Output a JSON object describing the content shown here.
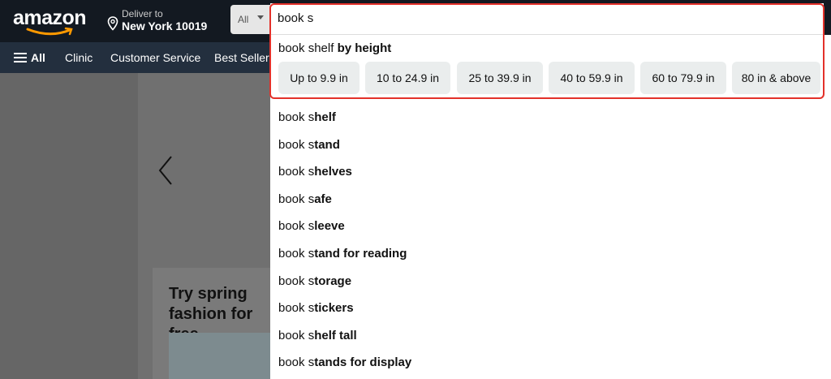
{
  "header": {
    "logo_text": "amazon",
    "deliver_label": "Deliver to",
    "deliver_location": "New York 10019",
    "search_category": "All",
    "search_value": "book s"
  },
  "nav": {
    "all_label": "All",
    "items": [
      "Clinic",
      "Customer Service",
      "Best Sellers"
    ]
  },
  "background": {
    "card_title": "Try spring fashion for free"
  },
  "dropdown": {
    "featured": {
      "prefix": "book shelf",
      "suffix": "by height"
    },
    "chips": [
      "Up to 9.9 in",
      "10 to 24.9 in",
      "25 to 39.9 in",
      "40 to 59.9 in",
      "60 to 79.9 in",
      "80 in & above"
    ],
    "suggestion_prefix": "book s",
    "suggestions": [
      {
        "typed": "book s",
        "completion": "helf"
      },
      {
        "typed": "book s",
        "completion": "tand"
      },
      {
        "typed": "book s",
        "completion": "helves"
      },
      {
        "typed": "book s",
        "completion": "afe"
      },
      {
        "typed": "book s",
        "completion": "leeve"
      },
      {
        "typed": "book s",
        "completion": "tand for reading"
      },
      {
        "typed": "book s",
        "completion": "torage"
      },
      {
        "typed": "book s",
        "completion": "tickers"
      },
      {
        "typed": "book s",
        "completion": "helf tall"
      },
      {
        "typed": "book s",
        "completion": "tands for display"
      }
    ]
  },
  "colors": {
    "header_bg": "#131921",
    "nav_bg": "#232f3e",
    "highlight_border": "#e3312a",
    "chip_bg": "#eaeded",
    "logo_smile": "#ff9900"
  }
}
